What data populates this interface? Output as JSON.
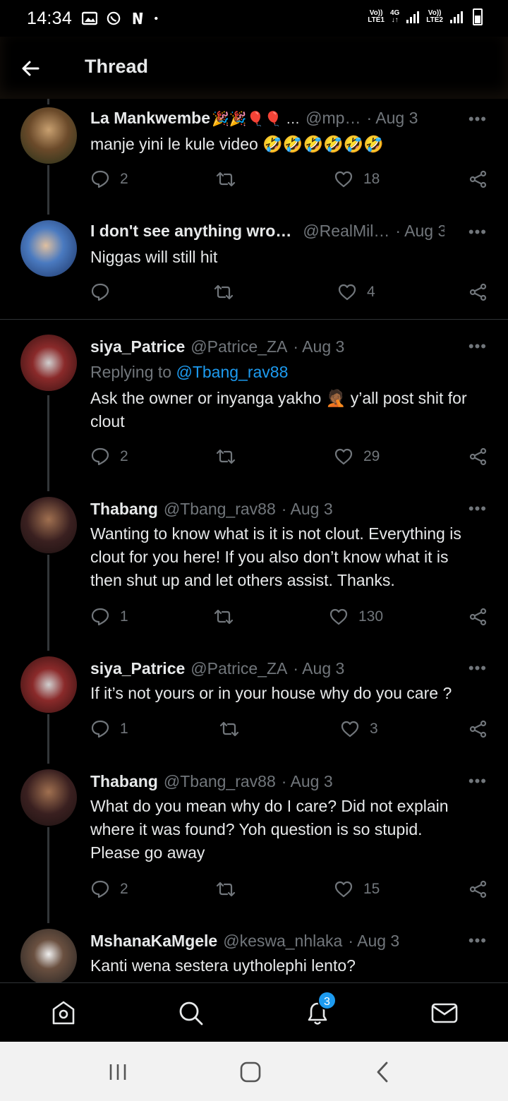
{
  "status_bar": {
    "time": "14:34",
    "icons": [
      "gallery-icon",
      "whatsapp-icon",
      "netflix-icon",
      "dot-icon"
    ],
    "sim1": {
      "label_top": "Vo))",
      "label_bottom": "LTE1"
    },
    "net": {
      "label_top": "4G",
      "label_bottom": "↓↑"
    },
    "sim2": {
      "label_top": "Vo))",
      "label_bottom": "LTE2"
    }
  },
  "header": {
    "title": "Thread"
  },
  "tweets": [
    {
      "name": "La Mankwembe",
      "name_emoji": "🎉🎉🎈🎈 …",
      "handle": "@mp…",
      "date": "· Aug 3",
      "text": "manje yini le kule video 🤣🤣🤣🤣🤣🤣",
      "replies": "2",
      "retweets": "",
      "likes": "18",
      "avatar_color": "#6b4a2a"
    },
    {
      "name": "I don't see anything wro…",
      "handle": "@RealMil…",
      "date": "· Aug 3",
      "text": "Niggas will still hit",
      "replies": "",
      "retweets": "",
      "likes": "4",
      "avatar_color": "#2c5aa0"
    },
    {
      "name": "siya_Patrice",
      "handle": "@Patrice_ZA",
      "date": "· Aug 3",
      "reply_prefix": "Replying to",
      "reply_mention": "@Tbang_rav88",
      "text": "Ask the owner or inyanga yakho 🤦🏾 y’all post shit for clout",
      "replies": "2",
      "retweets": "",
      "likes": "29",
      "avatar_color": "#7a2020"
    },
    {
      "name": "Thabang",
      "handle": "@Tbang_rav88",
      "date": "· Aug 3",
      "text": "Wanting to know what is it is not clout.  Everything is clout for you here! If you also don’t know what it is then shut up and let others assist. Thanks.",
      "replies": "1",
      "retweets": "",
      "likes": "130",
      "avatar_color": "#3a2a2a"
    },
    {
      "name": "siya_Patrice",
      "handle": "@Patrice_ZA",
      "date": "· Aug 3",
      "text": "If it’s not yours or in your house why do you care ?",
      "replies": "1",
      "retweets": "",
      "likes": "3",
      "avatar_color": "#7a2020"
    },
    {
      "name": "Thabang",
      "handle": "@Tbang_rav88",
      "date": "· Aug 3",
      "text": "What do you mean why do I care? Did not explain where it was found? Yoh question is so stupid. Please go away",
      "replies": "2",
      "retweets": "",
      "likes": "15",
      "avatar_color": "#3a2a2a"
    },
    {
      "name": "MshanaKaMgele",
      "handle": "@keswa_nhlaka",
      "date": "· Aug 3",
      "text": "Kanti wena sestera uytholephi lento?",
      "avatar_color": "#5a5a5a"
    }
  ],
  "more_label": "•••",
  "bottom_nav": {
    "notifications_badge": "3",
    "items": [
      "home-icon",
      "search-icon",
      "notifications-icon",
      "messages-icon"
    ]
  },
  "colors": {
    "background": "#000000",
    "text": "#e7e9ea",
    "secondary": "#71767b",
    "accent": "#1d9bf0"
  }
}
